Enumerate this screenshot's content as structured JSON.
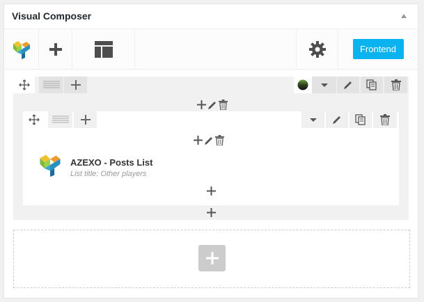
{
  "panel": {
    "title": "Visual Composer"
  },
  "navbar": {
    "logo": "vc-logo-icon",
    "add_element": "plus-icon",
    "templates": "layout-template-icon",
    "settings": "gear-icon",
    "frontend_label": "Frontend"
  },
  "element": {
    "title": "AZEXO - Posts List",
    "subtitle": "List title: Other players"
  },
  "colors": {
    "accent": "#08b3f0",
    "icon_dark": "#4e4e4e",
    "control_bg": "#e3e3e3"
  }
}
